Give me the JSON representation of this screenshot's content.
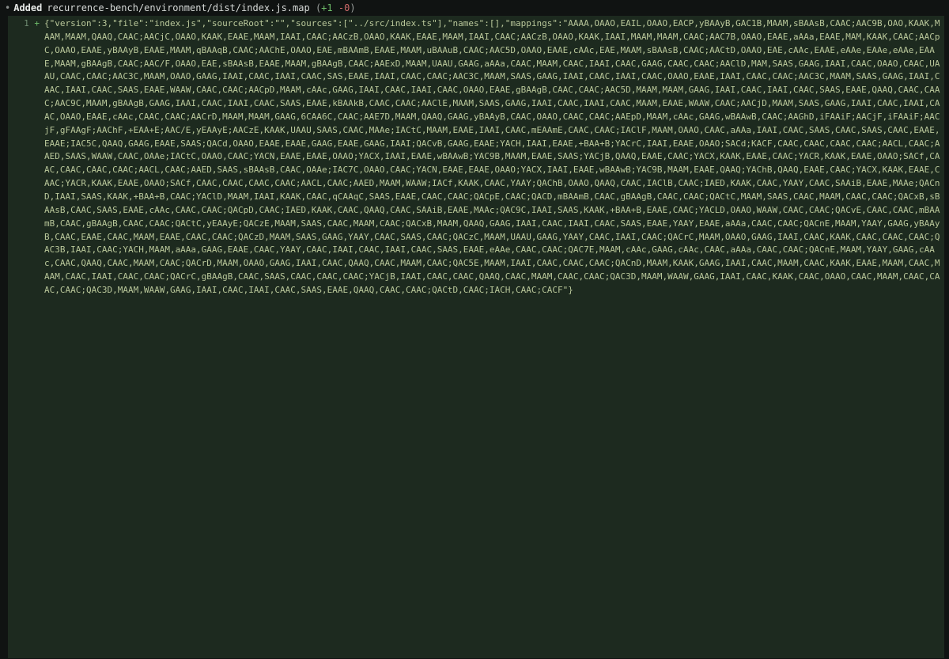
{
  "header": {
    "chevron": "•",
    "action": "Added",
    "path": "recurrence-bench/environment/dist/index.js.map",
    "stats_open": "(",
    "added": "+1",
    "removed": "-0",
    "stats_close": ")"
  },
  "diff": {
    "line_number": "1",
    "sign": "+",
    "content": "{\"version\":3,\"file\":\"index.js\",\"sourceRoot\":\"\",\"sources\":[\"../src/index.ts\"],\"names\":[],\"mappings\":\"AAAA,OAAO,EAIL,OAAO,EACP,yBAAyB,GAC1B,MAAM,sBAAsB,CAAC;AAC9B,OAO,KAAK,MAAM,MAAM,QAAQ,CAAC;AACjC,OAAO,KAAK,EAAE,MAAM,IAAI,CAAC;AACzB,OAAO,KAAK,EAAE,MAAM,IAAI,CAAC;AACzB,OAAO,KAAK,IAAI,MAAM,MAAM,CAAC;AAC7B,OAAO,EAAE,aAAa,EAAE,MAM,KAAK,CAAC;AACpC,OAAO,EAAE,yBAAyB,EAAE,MAAM,qBAAqB,CAAC;AAChE,OAAO,EAE,mBAAmB,EAAE,MAAM,uBAAuB,CAAC;AAC5D,OAAO,EAAE,cAAc,EAE,MAAM,sBAAsB,CAAC;AACtD,OAAO,EAE,cAAc,EAAE,eAAe,EAAe,eAAe,EAAE,MAAM,gBAAgB,CAAC;AAC/F,OAAO,EAE,sBAAsB,EAAE,MAAM,gBAAgB,CAAC;AAExD,MAAM,UAAU,GAAG,aAAa,CAAC,MAAM,CAAC,IAAI,CAAC,GAAG,CAAC,CAAC;AAClD,MAM,SAAS,GAAG,IAAI,CAAC,OAAO,CAAC,UAAU,CAAC,CAAC;AAC3C,MAAM,OAAO,GAAG,IAAI,CAAC,IAAI,CAAC,SAS,EAAE,IAAI,CAAC,CAAC;AAC3C,MAAM,SAAS,GAAG,IAAI,CAAC,IAAI,CAAC,OAAO,EAAE,IAAI,CAAC,CAAC;AAC3C,MAAM,SAAS,GAAG,IAAI,CAAC,IAAI,CAAC,SAAS,EAAE,WAAW,CAAC,CAAC;AACpD,MAAM,cAAc,GAAG,IAAI,CAAC,IAAI,CAAC,OAAO,EAAE,gBAAgB,CAAC,CAAC;AAC5D,MAAM,MAAM,GAAG,IAAI,CAAC,IAAI,CAAC,SAAS,EAAE,QAAQ,CAAC,CAAC;AAC9C,MAAM,gBAAgB,GAAG,IAAI,CAAC,IAAI,CAAC,SAAS,EAAE,kBAAkB,CAAC,CAAC;AAClE,MAAM,SAAS,GAAG,IAAI,CAAC,IAAI,CAAC,MAAM,EAAE,WAAW,CAAC;AACjD,MAAM,SAAS,GAAG,IAAI,CAAC,IAAI,CAAC,OAAO,EAAE,cAAc,CAAC,CAAC;AACrD,MAAM,MAAM,GAAG,6CAA6C,CAAC;AAE7D,MAAM,QAAQ,GAAG,yBAAyB,CAAC,OAAO,CAAC,CAAC;AAEpD,MAAM,cAAc,GAAG,wBAAwB,CAAC;AAGhD,iFAAiF;AACjF,iFAAiF;AACjF,gFAAgF;AAChF,+EAA+E;AAC/E,yEAAyE;AACzE,KAAK,UAAU,SAAS,CAAC,MAAe;IACtC,MAAM,EAAE,IAAI,CAAC,mEAAmE,CAAC,CAAC;IAClF,MAAM,OAAO,CAAC,aAAa,IAAI,CAAC,SAAS,CAAC,SAAS,CAAC,EAAE,EAAE;IAC5C,QAAQ,GAAG,EAAE,SAAS;QACd,OAAO,EAAE,EAAE,GAAG,EAAE,GAAG,IAAI;QACvB,GAAG,EAAE;YACH,IAAI,EAAE,+BAA+B;YACrC,IAAI,EAAE,OAAO;SACd;KACF,CAAC,CAAC,CAAC,CAAC;AACL,CAAC;AAED,SAAS,WAAW,CAAC,OAAe;IACtC,OAAO,CAAC;YACN,EAAE,EAAE,OAAO;YACX,IAAI,EAAE,wBAAwB;YAC9B,MAAM,EAAE,SAAS;YACjB,QAAQ,EAAE,CAAC;YACX,KAAK,EAAE,CAAC;YACR,KAAK,EAAE,OAAO;SACf,CAAC,CAAC,CAAC,CAAC;AACL,CAAC;AAED,SAAS,sBAAsB,CAAC,OAAe;IAC7C,OAAO,CAAC;YACN,EAAE,EAAE,OAAO;YACX,IAAI,EAAE,wBAAwB;YAC9B,MAAM,EAAE,QAAQ;YAChB,QAAQ,EAAE,CAAC;YACX,KAAK,EAAE,CAAC;YACR,KAAK,EAAE,OAAO;SACf,CAAC,CAAC,CAAC,CAAC;AACL,CAAC;AAED,MAAM,WAAW;IACf,KAAK,CAAC,YAAY;QAChB,OAAO,QAAQ,CAAC,IAClB,CAAC;IAED,KAAK,CAAC,YAAY,CAAC,SAAiB,EAAE,MAAe;QACnD,IAAI,SAAS,KAAK,+BAA+B,CAAC;YAClD,MAAM,IAAI,KAAK,CAAC,qCAAqC,SAAS,EAAE,CAAC,CAAC;QACpE,CAAC;QACD,mBAAmB,CAAC,gBAAgB,CAAC,CAAC;QACtC,MAAM,SAAS,CAAC,MAAM,CAAC,CAAC;QACxB,sBAAsB,CAAC,SAAS,EAAE,cAAc,CAAC,CAAC;QACpD,CAAC;IAED,KAAK,CAAC,QAAQ,CAAC,SAAiB,EAAE,MAAc;QAC9C,IAAI,SAAS,KAAK,+BAA+B,EAAE,CAAC;YACLD,OAAO,WAAW,CAAC,CAAC;QACvE,CAAC,CAAC,mBAAmB,CAAC,gBAAgB,CAAC,CAAC;QACtC,yEAAyE;QACzE,MAAM,SAAS,CAAC,MAAM,CAAC;QACxB,MAAM,QAAQ,GAAG,IAAI,CAAC,IAAI,CAAC,SAAS,EAAE,YAAY,EAAE,aAAa,CAAC,CAAC;QACnE,MAAM,YAAY,GAAG,yBAAyB,CAAC,EAAE,CAAC,MAAM,EAAE,CAAC,CAAC;QACzD,MAAM,SAAS,GAAG,YAAY,CAAC,SAAS,CAAC;QACzC,MAAM,UAAU,GAAG,YAAY,CAAC,IAAI,CAAC;QACrC,MAAM,OAAO,GAAG,IAAI,CAAC,KAAK,CAAC,CAAC,CAAC;QAC3B,IAAI,CAAC;YACH,MAAM,aAAa,GAAG,EAAE,CAAC,YAAY,CAAC,IAAI,CAAC,IAAI,CAAC,SAAS,EAAE,eAAe,CAAC,CAAC;QAC7E,MAAM,cAAc,GAAG,cAAc,CAAC,aAAa,CAAC,CAAC;QACnE,MAAM,YAAY,GAAG,cAAc,CAAC,QAAQ,CAAC,MAAM,CAAC;QACrD,MAAM,OAAO,GAAG,IAAI,CAAC,QAAQ,CAAC,MAAM,CAAC;QAC5E,MAAM,IAAI,CAAC,CAAC,CAAC;QACnD,MAAM,KAAK,GAAG,IAAI,CAAC,MAAM,CAAC,KAAK,EAAE,MAAM,CAAC,MAAM,CAAC,IAAI,CAAC,CAAC;QACrC,gBAAgB,CAAC,SAAS,CAAC,CAAC,CAAC;YACjB,IAAI,CAAC,CAAC,QAAQ,CAAC,MAAM,CAAC,CAAC;QAC3D,MAAM,WAAW,GAAG,IAAI,CAAC,KAAK,CAAC,OAAO,CAAC,MAAM,CAAC,CAAC,CAAC;QAC3D,MAAM,WAAW,GAAG,IAAI,CAAC,IAAI,CAAC,SAAS,EAAE,QAAQ,CAAC,CAAC;QACtD,CAAC;IACH,CAAC;CACF\"}"
  }
}
